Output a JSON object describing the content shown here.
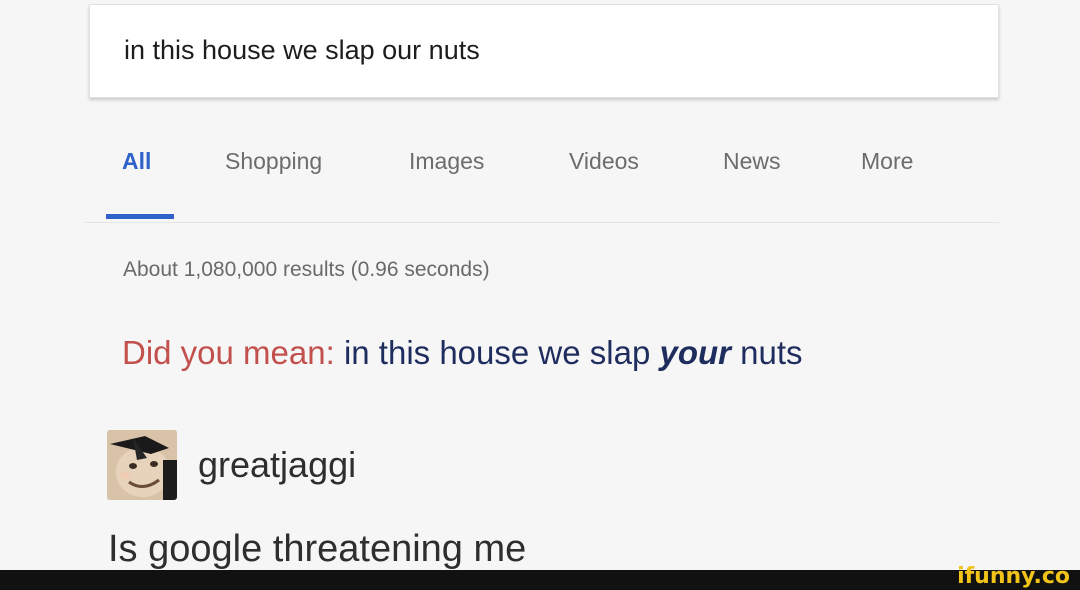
{
  "search": {
    "query": "in this house we slap our nuts"
  },
  "tabs": [
    {
      "label": "All",
      "active": true
    },
    {
      "label": "Shopping",
      "active": false
    },
    {
      "label": "Images",
      "active": false
    },
    {
      "label": "Videos",
      "active": false
    },
    {
      "label": "News",
      "active": false
    },
    {
      "label": "More",
      "active": false
    }
  ],
  "results": {
    "stats": "About 1,080,000 results (0.96 seconds)",
    "did_you_mean": {
      "label": "Did you mean:",
      "before": "in this house we slap",
      "emphasis": "your",
      "after": "nuts"
    }
  },
  "post": {
    "username": "greatjaggi",
    "comment": "Is google threatening me"
  },
  "watermark": {
    "text": "ifunny.co"
  },
  "colors": {
    "accent": "#2f63c9",
    "did_you_mean_label": "#c2504c",
    "did_you_mean_query": "#1f2d5e",
    "watermark": "#f2c318"
  }
}
